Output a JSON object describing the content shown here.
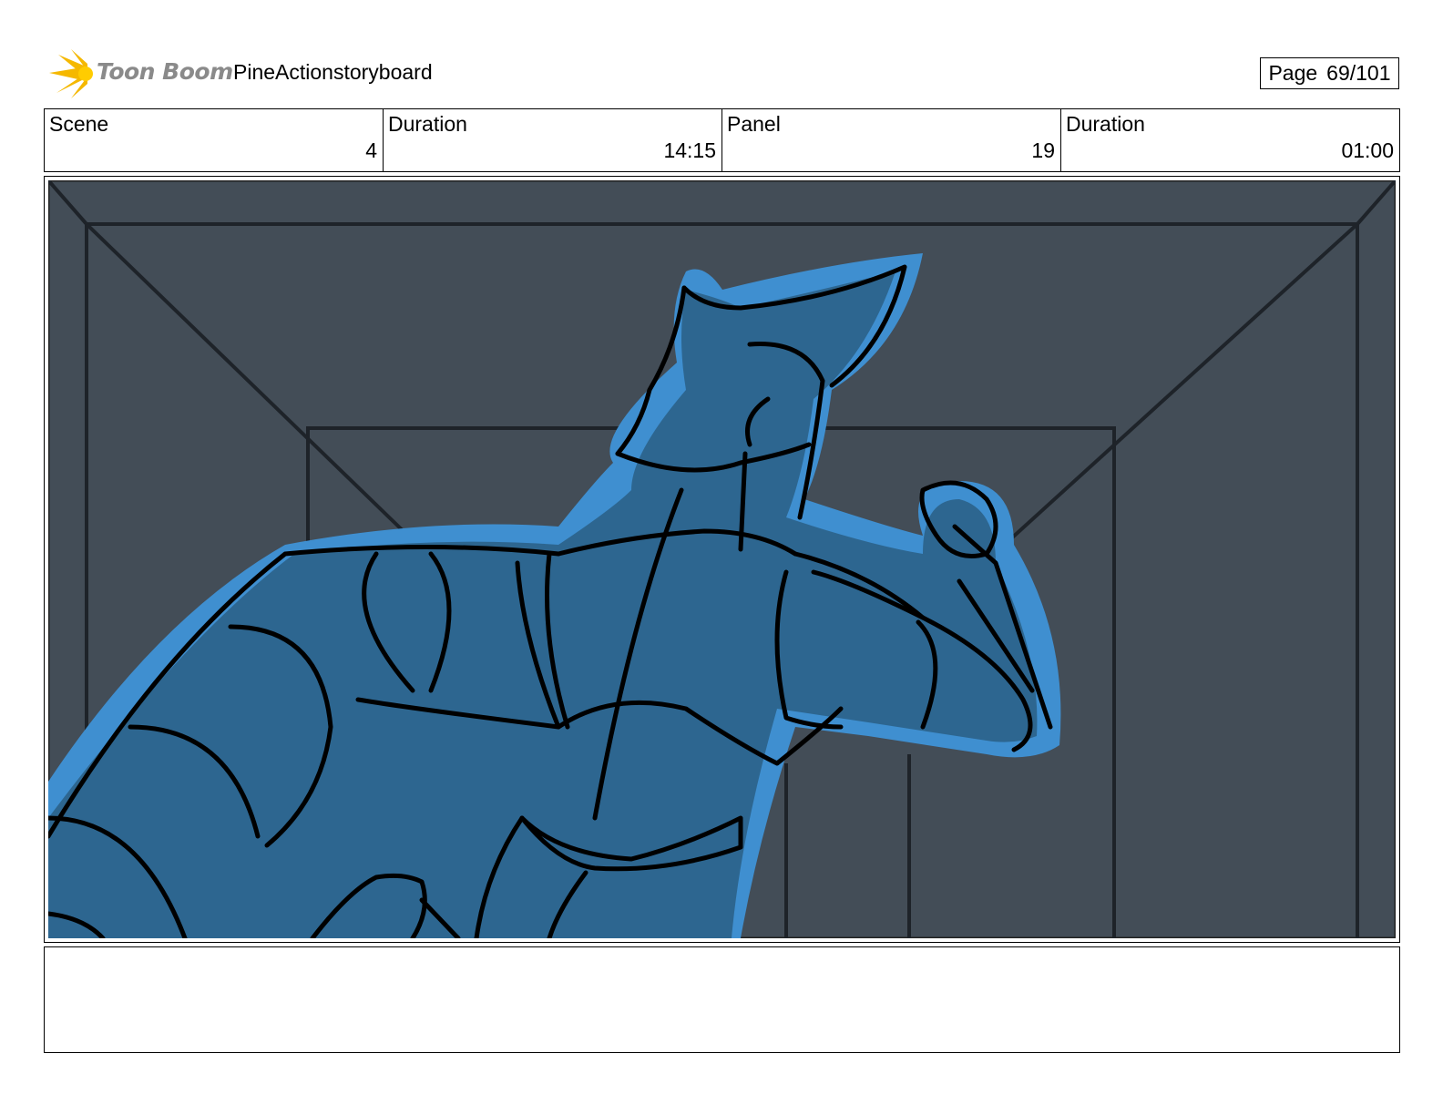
{
  "header": {
    "logo_text": "Toon Boom",
    "project_title": "PineActionstoryboard",
    "page_label": "Page",
    "page_number": "69/101"
  },
  "info": {
    "scene_label": "Scene",
    "scene_value": "4",
    "scene_duration_label": "Duration",
    "scene_duration_value": "14:15",
    "panel_label": "Panel",
    "panel_value": "19",
    "panel_duration_label": "Duration",
    "panel_duration_value": "01:00"
  },
  "colors": {
    "room_wall": "#434d57",
    "character_fill": "#2d6690",
    "character_glow": "#3f8fd0",
    "logo_yellow": "#f5b800",
    "logo_text": "#8a8a8a"
  },
  "caption": {
    "text": ""
  }
}
